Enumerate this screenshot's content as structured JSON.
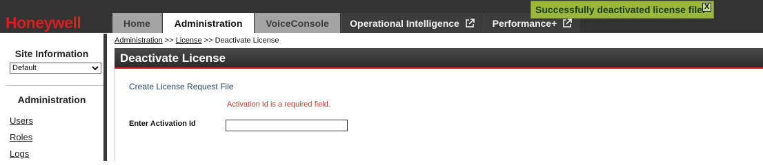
{
  "brand": {
    "logo_text": "Honeywell",
    "logo_color": "#d81e1e"
  },
  "nav": {
    "tabs": [
      {
        "label": "Home",
        "active": false
      },
      {
        "label": "Administration",
        "active": true
      },
      {
        "label": "VoiceConsole",
        "active": false
      },
      {
        "label": "Operational Intelligence",
        "external": true,
        "icon": "external-link-icon"
      },
      {
        "label": "Performance+",
        "external": true,
        "icon": "external-link-icon"
      }
    ]
  },
  "toast": {
    "message": "Successfully deactivated license file.",
    "close_glyph": "X",
    "color": "#9ab73c"
  },
  "sidebar": {
    "site_title": "Site Information",
    "site_select_value": "Default",
    "admin_title": "Administration",
    "links": [
      "Users",
      "Roles",
      "Logs"
    ]
  },
  "breadcrumb": {
    "part1": "Administration",
    "sep1": " >> ",
    "part2": "License",
    "sep2": " >> ",
    "current": "Deactivate License"
  },
  "page": {
    "title": "Deactivate License",
    "section_label": "Create License Request File",
    "error_message": "Activation Id is a required field.",
    "field_label": "Enter Activation Id",
    "field_value": "",
    "field_placeholder": ""
  }
}
